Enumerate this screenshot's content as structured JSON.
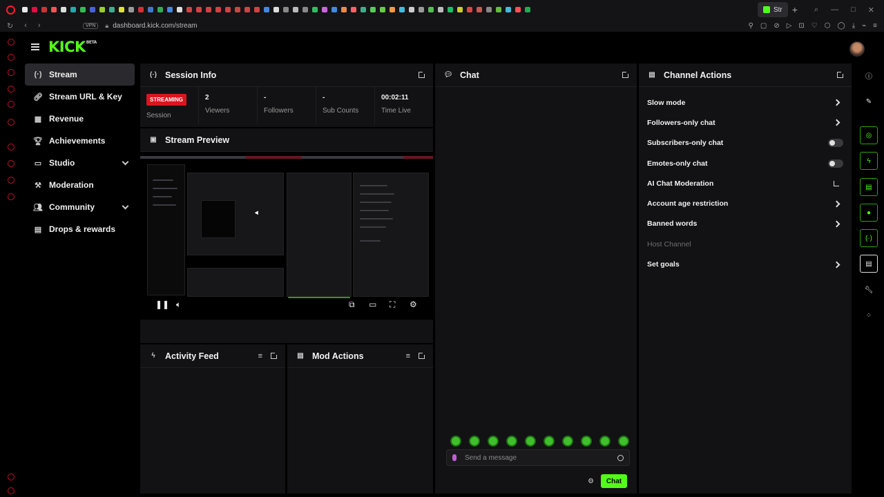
{
  "browser": {
    "active_tab_label": "Str",
    "url": "dashboard.kick.com/stream",
    "vpn_label": "VPN"
  },
  "header": {
    "logo_text": "KICK",
    "logo_badge": "BETA"
  },
  "sidebar": {
    "items": [
      {
        "label": "Stream",
        "icon": "broadcast-icon"
      },
      {
        "label": "Stream URL & Key",
        "icon": "link-icon"
      },
      {
        "label": "Revenue",
        "icon": "revenue-icon"
      },
      {
        "label": "Achievements",
        "icon": "trophy-icon"
      },
      {
        "label": "Studio",
        "icon": "studio-icon"
      },
      {
        "label": "Moderation",
        "icon": "gavel-icon"
      },
      {
        "label": "Community",
        "icon": "community-icon"
      },
      {
        "label": "Drops & rewards",
        "icon": "gift-icon"
      }
    ]
  },
  "session_info": {
    "title": "Session Info",
    "status_badge": "STREAMING",
    "session_label": "Session",
    "stats": [
      {
        "value": "2",
        "label": "Viewers"
      },
      {
        "value": "-",
        "label": "Followers"
      },
      {
        "value": "-",
        "label": "Sub Counts"
      },
      {
        "value": "00:02:11",
        "label": "Time Live"
      }
    ]
  },
  "stream_preview": {
    "title": "Stream Preview"
  },
  "activity_feed": {
    "title": "Activity Feed"
  },
  "mod_actions": {
    "title": "Mod Actions"
  },
  "chat": {
    "title": "Chat",
    "input_placeholder": "Send a message",
    "send_label": "Chat"
  },
  "channel_actions": {
    "title": "Channel Actions",
    "items": [
      {
        "label": "Slow mode",
        "control": "arrow"
      },
      {
        "label": "Followers-only chat",
        "control": "arrow"
      },
      {
        "label": "Subscribers-only chat",
        "control": "toggle",
        "on": false
      },
      {
        "label": "Emotes-only chat",
        "control": "toggle",
        "on": false
      },
      {
        "label": "AI Chat Moderation",
        "control": "external"
      },
      {
        "label": "Account age restriction",
        "control": "arrow"
      },
      {
        "label": "Banned words",
        "control": "arrow"
      },
      {
        "label": "Host Channel",
        "control": "none",
        "disabled": true
      },
      {
        "label": "Set goals",
        "control": "arrow"
      }
    ]
  },
  "colors": {
    "accent": "#53fc18",
    "streaming_red": "#d9161f",
    "panel_bg": "#121214"
  }
}
